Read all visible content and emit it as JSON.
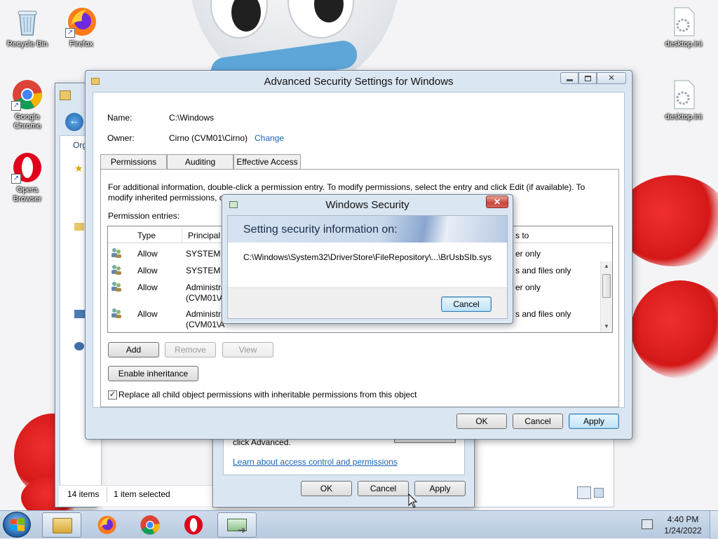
{
  "desktop": {
    "icons": [
      {
        "label": "Recycle Bin"
      },
      {
        "label": "Firefox"
      },
      {
        "label": "Google Chrome"
      },
      {
        "label": "Opera Browser"
      },
      {
        "label": "desktop.ini"
      },
      {
        "label": "desktop.ini"
      }
    ]
  },
  "explorer": {
    "toolbar_label": "Org",
    "status_items": "14 items",
    "status_selected": "1 item selected"
  },
  "properties": {
    "hint_text": "click Advanced.",
    "learn_link": "Learn about access control and permissions",
    "ok": "OK",
    "cancel": "Cancel",
    "apply": "Apply"
  },
  "advanced": {
    "title": "Advanced Security Settings for Windows",
    "name_label": "Name:",
    "name_value": "C:\\Windows",
    "owner_label": "Owner:",
    "owner_value": "Cirno (CVM01\\Cirno)",
    "owner_change": "Change",
    "tabs": [
      {
        "label": "Permissions"
      },
      {
        "label": "Auditing"
      },
      {
        "label": "Effective Access"
      }
    ],
    "info_text_1": "For additional information, double-click a permission entry. To modify permissions, select the entry and click Edit (if available). To",
    "info_text_2a": "modify inherited permissions, c",
    "entries_label": "Permission entries:",
    "columns": {
      "type": "Type",
      "principal": "Principal",
      "applies": "s to"
    },
    "rows": [
      {
        "type": "Allow",
        "principal": "SYSTEM",
        "principal2": "",
        "applies": "er only"
      },
      {
        "type": "Allow",
        "principal": "SYSTEM",
        "principal2": "",
        "applies": "s and files only"
      },
      {
        "type": "Allow",
        "principal": "Administra",
        "principal2": "(CVM01\\A",
        "applies": "er only"
      },
      {
        "type": "Allow",
        "principal": "Administra",
        "principal2": "(CVM01\\A",
        "applies": "s and files only"
      }
    ],
    "add": "Add",
    "remove": "Remove",
    "view": "View",
    "enable_inheritance": "Enable inheritance",
    "replace_checkbox": "Replace all child object permissions with inheritable permissions from this object",
    "replace_checked": true,
    "ok": "OK",
    "cancel": "Cancel",
    "apply": "Apply"
  },
  "security_dialog": {
    "title": "Windows Security",
    "heading": "Setting security information on:",
    "path": "C:\\Windows\\System32\\DriverStore\\FileRepository\\...\\BrUsbSIb.sys",
    "cancel": "Cancel",
    "close_glyph": "✕"
  },
  "taskbar": {
    "time": "4:40 PM",
    "date": "1/24/2022"
  },
  "colors": {
    "accent_link": "#1a64b4",
    "close_red": "#c7453b",
    "title_glass": "#dbe6f3"
  }
}
